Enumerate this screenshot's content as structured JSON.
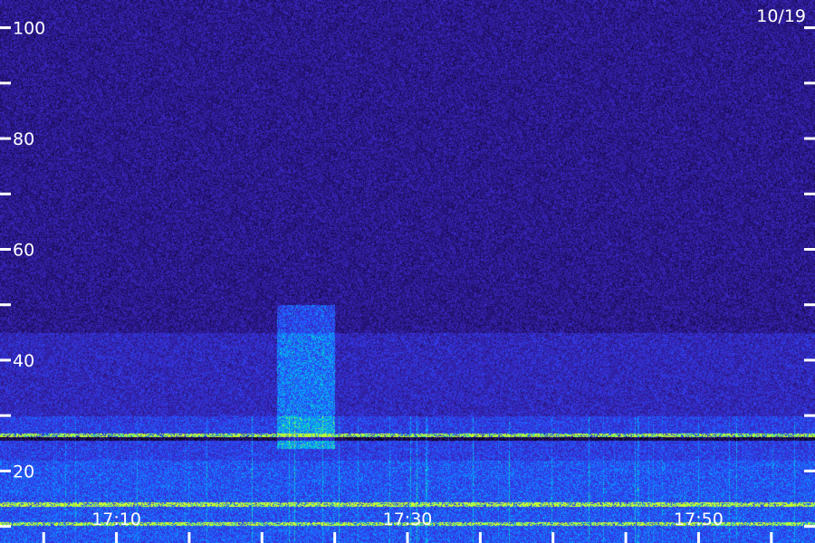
{
  "chart_data": {
    "type": "heatmap",
    "title": "",
    "xlabel": "",
    "ylabel": "",
    "date_label": "10/19",
    "y_ticks": [
      {
        "value": 100,
        "label": "100"
      },
      {
        "value": 90,
        "label": ""
      },
      {
        "value": 80,
        "label": "80"
      },
      {
        "value": 70,
        "label": ""
      },
      {
        "value": 60,
        "label": "60"
      },
      {
        "value": 50,
        "label": ""
      },
      {
        "value": 40,
        "label": "40"
      },
      {
        "value": 30,
        "label": ""
      },
      {
        "value": 20,
        "label": "20"
      },
      {
        "value": 10,
        "label": ""
      }
    ],
    "x_ticks": [
      {
        "value": "17:05",
        "label": ""
      },
      {
        "value": "17:10",
        "label": "17:10"
      },
      {
        "value": "17:15",
        "label": ""
      },
      {
        "value": "17:20",
        "label": ""
      },
      {
        "value": "17:25",
        "label": ""
      },
      {
        "value": "17:30",
        "label": "17:30"
      },
      {
        "value": "17:35",
        "label": ""
      },
      {
        "value": "17:40",
        "label": ""
      },
      {
        "value": "17:45",
        "label": ""
      },
      {
        "value": "17:50",
        "label": "17:50"
      },
      {
        "value": "17:55",
        "label": ""
      }
    ],
    "ylim": [
      7,
      105
    ],
    "xlim": [
      "17:02",
      "17:58"
    ],
    "colormap": [
      "#000000",
      "#1a0a55",
      "#2d1a8c",
      "#3b2bd0",
      "#2450ff",
      "#0aa0ff",
      "#00e0c0",
      "#c8ff30"
    ],
    "features": [
      {
        "kind": "band",
        "low": 7,
        "high": 22,
        "level": 0.55
      },
      {
        "kind": "band",
        "low": 22,
        "high": 30,
        "level": 0.42
      },
      {
        "kind": "band",
        "low": 30,
        "high": 45,
        "level": 0.22
      },
      {
        "kind": "burst",
        "t_start": "17:21",
        "t_end": "17:25",
        "low": 24,
        "high": 50,
        "level": 0.35
      },
      {
        "kind": "line",
        "freq": 26.5,
        "level": 0.75
      },
      {
        "kind": "line",
        "freq": 14,
        "level": 0.8
      },
      {
        "kind": "line",
        "freq": 10.5,
        "level": 0.7
      }
    ]
  }
}
